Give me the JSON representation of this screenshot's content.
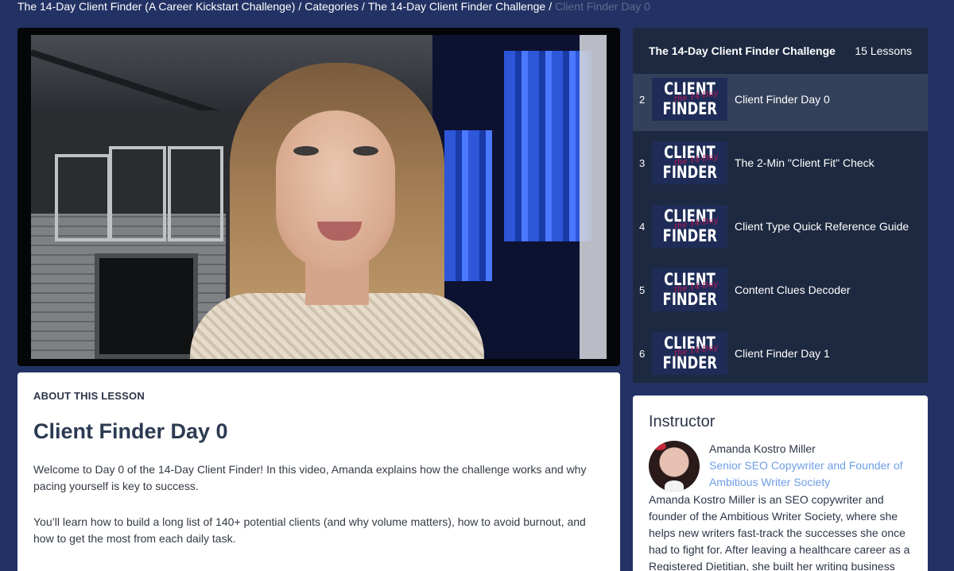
{
  "breadcrumb": {
    "items": [
      "The 14-Day Client Finder (A Career Kickstart Challenge)",
      "Categories",
      "The 14-Day Client Finder Challenge"
    ],
    "separator": "/",
    "current": "Client Finder Day 0"
  },
  "lesson_panel": {
    "title": "The 14-Day Client Finder Challenge",
    "count": "15 Lessons",
    "thumb_line1": "CLIENT",
    "thumb_line2": "FINDER",
    "thumb_script": "the 14-Day",
    "items": [
      {
        "num": "",
        "title": ""
      },
      {
        "num": "2",
        "title": "Client Finder Day 0"
      },
      {
        "num": "3",
        "title": "The 2-Min \"Client Fit\" Check"
      },
      {
        "num": "4",
        "title": "Client Type Quick Reference Guide"
      },
      {
        "num": "5",
        "title": "Content Clues Decoder"
      },
      {
        "num": "6",
        "title": "Client Finder Day 1"
      }
    ]
  },
  "about": {
    "label": "ABOUT THIS LESSON",
    "title": "Client Finder Day 0",
    "paragraphs": [
      "Welcome to Day 0 of the 14-Day Client Finder! In this video, Amanda explains how the challenge works and why pacing yourself is key to success.",
      "You’ll learn how to build a long list of 140+ potential clients (and why volume matters), how to avoid burnout, and how to get the most from each daily task."
    ]
  },
  "instructor": {
    "heading": "Instructor",
    "name": "Amanda Kostro Miller",
    "role": "Senior SEO Copywriter and Founder of Ambitious Writer Society",
    "bio": "Amanda Kostro Miller is an SEO copywriter and founder of the Ambitious Writer Society, where she helps new writers fast-track the successes she once had to fight for. After leaving a healthcare career as a Registered Dietitian, she built her writing business"
  },
  "colors": {
    "page_bg": "#233264",
    "panel_bg": "#1d2940",
    "active_item_bg": "#34415a",
    "link_blue": "#6d9ee6",
    "breadcrumb_current": "#5d6a90"
  }
}
